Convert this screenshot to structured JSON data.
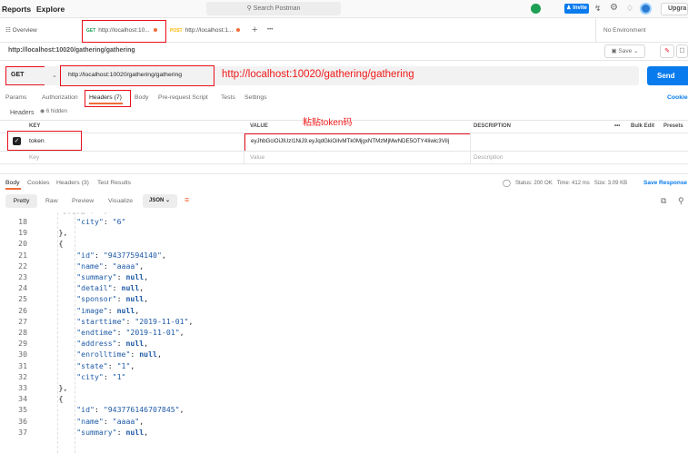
{
  "app": {
    "nav": [
      "Reports",
      "Explore"
    ],
    "search_placeholder": "Search Postman",
    "invite_label": "Invite",
    "upgrade_label": "Upgra"
  },
  "tabs": {
    "overview": "Overview",
    "tab1": {
      "method": "GET",
      "label": "http://localhost:10..."
    },
    "tab2": {
      "method": "POST",
      "label": "http://localhost:1..."
    },
    "add": "+",
    "more": "•••",
    "environment": "No Environment"
  },
  "request": {
    "name": "http://localhost:10020/gathering/gathering",
    "save_label": "Save",
    "method": "GET",
    "url": "http://localhost:10020/gathering/gathering",
    "annotation_url": "http://localhost:10020/gathering/gathering",
    "send_label": "Send",
    "cookies_label": "Cookie"
  },
  "request_tabs": [
    "Params",
    "Authorization",
    "Headers (7)",
    "Body",
    "Pre-request Script",
    "Tests",
    "Settings"
  ],
  "headers_section": {
    "title": "Headers",
    "hidden": "6 hidden",
    "col_key": "KEY",
    "col_value": "VALUE",
    "col_description": "DESCRIPTION",
    "more": "•••",
    "bulk_edit": "Bulk Edit",
    "presets": "Presets",
    "annotation_token": "粘贴token码",
    "row_key": "token",
    "row_value": "eyJhbGciOiJIUzI1NiJ9.eyJqdGkiOiIvMTk0MjgxNTMzMjMwNDE5OTY4Iiwic3ViIj",
    "placeholder_key": "Key",
    "placeholder_value": "Value",
    "placeholder_description": "Description"
  },
  "response": {
    "tabs": [
      "Body",
      "Cookies",
      "Headers (3)",
      "Test Results"
    ],
    "status": "Status: 200 OK",
    "time": "Time: 412 ms",
    "size": "Size: 3.09 KB",
    "save_response": "Save Response",
    "views": [
      "Pretty",
      "Raw",
      "Preview",
      "Visualize"
    ],
    "format": "JSON"
  },
  "code_lines": [
    {
      "n": "18",
      "indent": 3,
      "key": "city",
      "val": "\"6\"",
      "type": "s",
      "comma": false
    },
    {
      "n": "19",
      "indent": 2,
      "raw": "},"
    },
    {
      "n": "20",
      "indent": 2,
      "raw": "{"
    },
    {
      "n": "21",
      "indent": 3,
      "key": "id",
      "val": "\"94377594140\"",
      "type": "s",
      "comma": true
    },
    {
      "n": "22",
      "indent": 3,
      "key": "name",
      "val": "\"aaaa\"",
      "type": "s",
      "comma": true
    },
    {
      "n": "23",
      "indent": 3,
      "key": "summary",
      "val": "null",
      "type": "n",
      "comma": true
    },
    {
      "n": "24",
      "indent": 3,
      "key": "detail",
      "val": "null",
      "type": "n",
      "comma": true
    },
    {
      "n": "25",
      "indent": 3,
      "key": "sponsor",
      "val": "null",
      "type": "n",
      "comma": true
    },
    {
      "n": "26",
      "indent": 3,
      "key": "image",
      "val": "null",
      "type": "n",
      "comma": true
    },
    {
      "n": "27",
      "indent": 3,
      "key": "starttime",
      "val": "\"2019-11-01\"",
      "type": "s",
      "comma": true
    },
    {
      "n": "28",
      "indent": 3,
      "key": "endtime",
      "val": "\"2019-11-01\"",
      "type": "s",
      "comma": true
    },
    {
      "n": "29",
      "indent": 3,
      "key": "address",
      "val": "null",
      "type": "n",
      "comma": true
    },
    {
      "n": "30",
      "indent": 3,
      "key": "enrolltime",
      "val": "null",
      "type": "n",
      "comma": true
    },
    {
      "n": "31",
      "indent": 3,
      "key": "state",
      "val": "\"1\"",
      "type": "s",
      "comma": true
    },
    {
      "n": "32",
      "indent": 3,
      "key": "city",
      "val": "\"1\"",
      "type": "s",
      "comma": false
    },
    {
      "n": "33",
      "indent": 2,
      "raw": "},"
    },
    {
      "n": "34",
      "indent": 2,
      "raw": "{"
    },
    {
      "n": "35",
      "indent": 3,
      "key": "id",
      "val": "\"943776146707845\"",
      "type": "s",
      "comma": true
    },
    {
      "n": "36",
      "indent": 3,
      "key": "name",
      "val": "\"aaaa\"",
      "type": "s",
      "comma": true
    },
    {
      "n": "37",
      "indent": 3,
      "key": "summary",
      "val": "null",
      "type": "n",
      "comma": true
    }
  ],
  "colors": {
    "accent": "#097bed",
    "annotation": "#e8101d",
    "string": "#1f5aa6"
  }
}
